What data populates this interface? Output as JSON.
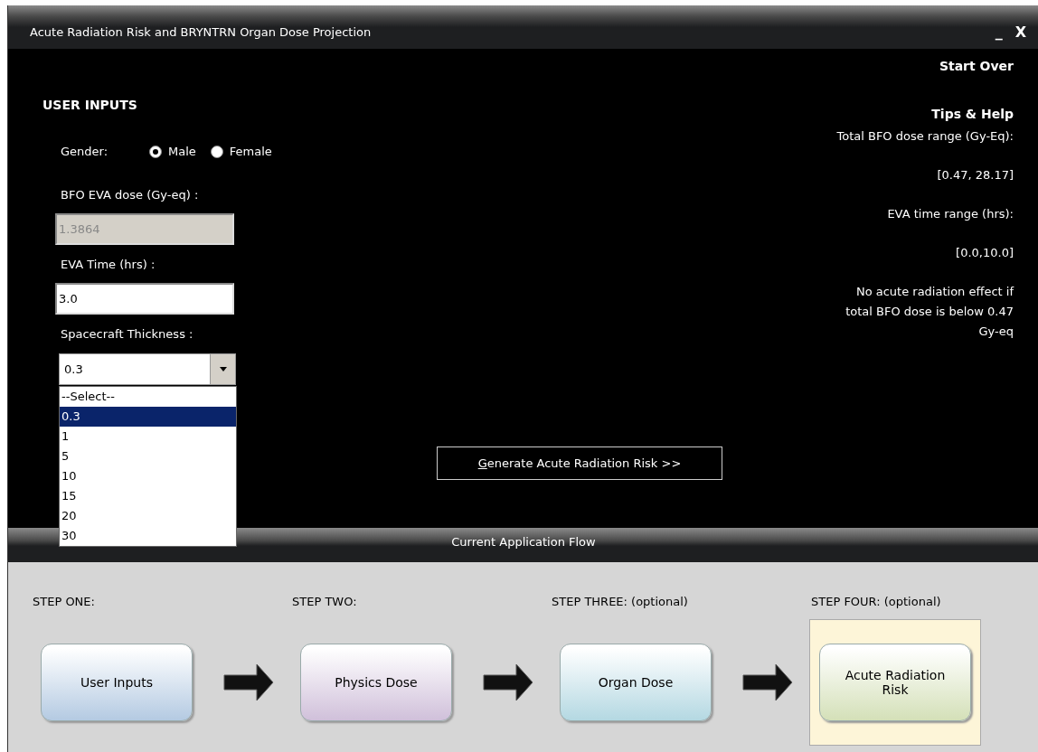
{
  "window": {
    "title": "Acute Radiation Risk and BRYNTRN  Organ Dose Projection",
    "controls": [
      "_",
      "X"
    ]
  },
  "start_over": "Start Over",
  "user_inputs": {
    "heading": "USER INPUTS",
    "gender": {
      "label": "Gender:",
      "options": [
        {
          "label": "Male",
          "selected": true
        },
        {
          "label": "Female",
          "selected": false
        }
      ]
    },
    "fields": [
      {
        "label": "BFO EVA dose (Gy-eq) :",
        "value": "1.3864",
        "disabled": true
      },
      {
        "label": "EVA Time (hrs) :",
        "value": "3.0",
        "disabled": false
      }
    ],
    "thickness": {
      "label": "Spacecraft Thickness :",
      "value": "0.3",
      "expanded": true,
      "options": [
        {
          "label": "--Select--",
          "selected": false
        },
        {
          "label": "0.3",
          "selected": true
        },
        {
          "label": "1",
          "selected": false
        },
        {
          "label": "5",
          "selected": false
        },
        {
          "label": "10",
          "selected": false
        },
        {
          "label": "15",
          "selected": false
        },
        {
          "label": "20",
          "selected": false
        },
        {
          "label": "30",
          "selected": false
        }
      ]
    }
  },
  "generate_button": "Generate Acute Radiation Risk >>",
  "tips": {
    "heading": "Tips & Help",
    "lines": [
      "Total BFO dose range (Gy-Eq):",
      "[0.47, 28.17]",
      "EVA time range (hrs):",
      "[0.0,10.0]",
      "No acute radiation effect if total BFO dose is below 0.47 Gy-eq"
    ]
  },
  "flow": {
    "title": "Current Application Flow",
    "steps": [
      {
        "label": "STEP ONE:",
        "button": "User Inputs",
        "color": "#b4cae2",
        "selected": false
      },
      {
        "label": "STEP TWO:",
        "button": "Physics Dose",
        "color": "#d0c0da",
        "selected": false
      },
      {
        "label": "STEP THREE: (optional)",
        "button": "Organ Dose",
        "color": "#b4d8e2",
        "selected": false
      },
      {
        "label": "STEP FOUR: (optional)",
        "button": "Acute Radiation Risk",
        "color": "#d4e0b8",
        "selected": true
      }
    ]
  }
}
